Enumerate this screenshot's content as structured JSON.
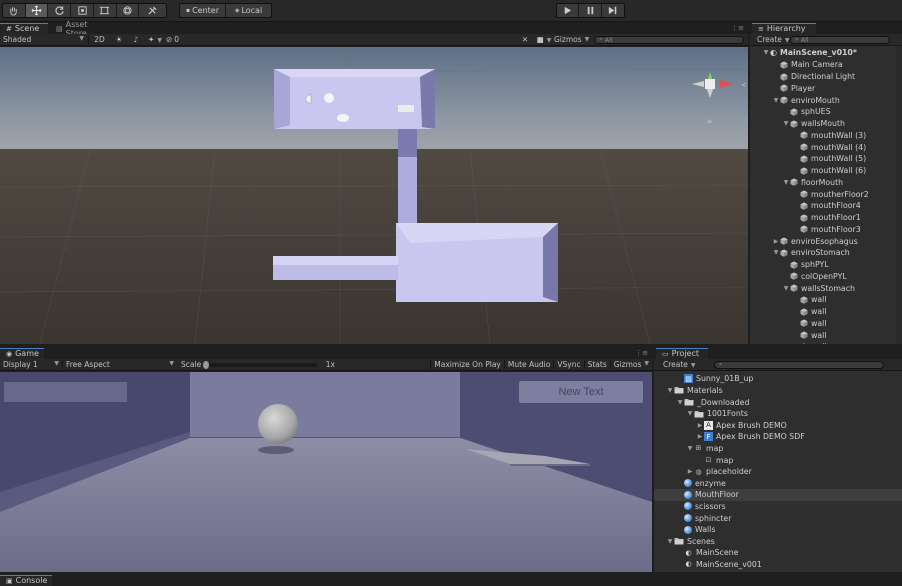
{
  "toolbar": {
    "tools": [
      "hand-tool-icon",
      "move-tool-icon",
      "rotate-tool-icon",
      "scale-tool-icon",
      "rect-tool-icon",
      "transform-tool-icon",
      "custom-tool-icon"
    ],
    "pivot_label": "Center",
    "space_label": "Local"
  },
  "scene": {
    "tab_label": "Scene",
    "asset_store_label": "Asset Store",
    "shading": "Shaded",
    "mode_2d": "2D",
    "fx_count": "0",
    "gizmos_label": "Gizmos",
    "search_placeholder": "All"
  },
  "hierarchy": {
    "tab_label": "Hierarchy",
    "create_label": "Create",
    "search_placeholder": "All",
    "scene_name": "MainScene_v010*",
    "items": [
      {
        "label": "Main Camera",
        "depth": 1,
        "expand": ""
      },
      {
        "label": "Directional Light",
        "depth": 1,
        "expand": ""
      },
      {
        "label": "Player",
        "depth": 1,
        "expand": ""
      },
      {
        "label": "enviroMouth",
        "depth": 1,
        "expand": "open"
      },
      {
        "label": "sphUES",
        "depth": 2,
        "expand": ""
      },
      {
        "label": "wallsMouth",
        "depth": 2,
        "expand": "open"
      },
      {
        "label": "mouthWall (3)",
        "depth": 3,
        "expand": ""
      },
      {
        "label": "mouthWall (4)",
        "depth": 3,
        "expand": ""
      },
      {
        "label": "mouthWall (5)",
        "depth": 3,
        "expand": ""
      },
      {
        "label": "mouthWall (6)",
        "depth": 3,
        "expand": ""
      },
      {
        "label": "floorMouth",
        "depth": 2,
        "expand": "open"
      },
      {
        "label": "moutherFloor2",
        "depth": 3,
        "expand": ""
      },
      {
        "label": "mouthFloor4",
        "depth": 3,
        "expand": ""
      },
      {
        "label": "mouthFloor1",
        "depth": 3,
        "expand": ""
      },
      {
        "label": "mouthFloor3",
        "depth": 3,
        "expand": ""
      },
      {
        "label": "enviroEsophagus",
        "depth": 1,
        "expand": "closed"
      },
      {
        "label": "enviroStomach",
        "depth": 1,
        "expand": "open"
      },
      {
        "label": "sphPYL",
        "depth": 2,
        "expand": ""
      },
      {
        "label": "colOpenPYL",
        "depth": 2,
        "expand": ""
      },
      {
        "label": "wallsStomach",
        "depth": 2,
        "expand": "open"
      },
      {
        "label": "wall",
        "depth": 3,
        "expand": ""
      },
      {
        "label": "wall",
        "depth": 3,
        "expand": ""
      },
      {
        "label": "wall",
        "depth": 3,
        "expand": ""
      },
      {
        "label": "wall",
        "depth": 3,
        "expand": ""
      },
      {
        "label": "wall",
        "depth": 3,
        "expand": ""
      }
    ]
  },
  "game": {
    "tab_label": "Game",
    "display": "Display 1",
    "aspect": "Free Aspect",
    "scale_label": "Scale",
    "scale_value": "1x",
    "scale_fraction": 0.0,
    "maximize_label": "Maximize On Play",
    "mute_label": "Mute Audio",
    "vsync_label": "VSync",
    "stats_label": "Stats",
    "gizmos_label": "Gizmos",
    "ui_button_text": "New Text"
  },
  "project": {
    "tab_label": "Project",
    "create_label": "Create",
    "items": [
      {
        "label": "Sunny_01B_up",
        "depth": 1,
        "icon": "texture-icon",
        "expand": ""
      },
      {
        "label": "Materials",
        "depth": 0,
        "icon": "folder-icon",
        "expand": "open"
      },
      {
        "label": "_Downloaded",
        "depth": 1,
        "icon": "folder-icon",
        "expand": "open"
      },
      {
        "label": "1001Fonts",
        "depth": 2,
        "icon": "folder-icon",
        "expand": "open"
      },
      {
        "label": "Apex Brush DEMO",
        "depth": 3,
        "icon": "font-icon",
        "expand": "closed"
      },
      {
        "label": "Apex Brush DEMO SDF",
        "depth": 3,
        "icon": "font-asset-icon",
        "expand": "closed"
      },
      {
        "label": "map",
        "depth": 2,
        "icon": "prefab-icon",
        "expand": "open"
      },
      {
        "label": "map",
        "depth": 3,
        "icon": "mesh-icon",
        "expand": ""
      },
      {
        "label": "placeholder",
        "depth": 2,
        "icon": "shader-icon",
        "expand": "closed"
      },
      {
        "label": "enzyme",
        "depth": 1,
        "icon": "material-icon",
        "expand": ""
      },
      {
        "label": "MouthFloor",
        "depth": 1,
        "icon": "material-icon",
        "expand": "",
        "selected": true
      },
      {
        "label": "scissors",
        "depth": 1,
        "icon": "material-icon",
        "expand": ""
      },
      {
        "label": "sphincter",
        "depth": 1,
        "icon": "material-icon",
        "expand": ""
      },
      {
        "label": "Walls",
        "depth": 1,
        "icon": "material-icon",
        "expand": ""
      },
      {
        "label": "Scenes",
        "depth": 0,
        "icon": "folder-icon",
        "expand": "open"
      },
      {
        "label": "MainScene",
        "depth": 1,
        "icon": "scene-icon",
        "expand": ""
      },
      {
        "label": "MainScene_v001",
        "depth": 1,
        "icon": "scene-icon",
        "expand": ""
      }
    ]
  },
  "console": {
    "tab_label": "Console"
  },
  "colors": {
    "accent": "#4a7fbf",
    "panel": "#282828",
    "selection": "#3e3e3e",
    "geometry": "#c9c6f0"
  }
}
